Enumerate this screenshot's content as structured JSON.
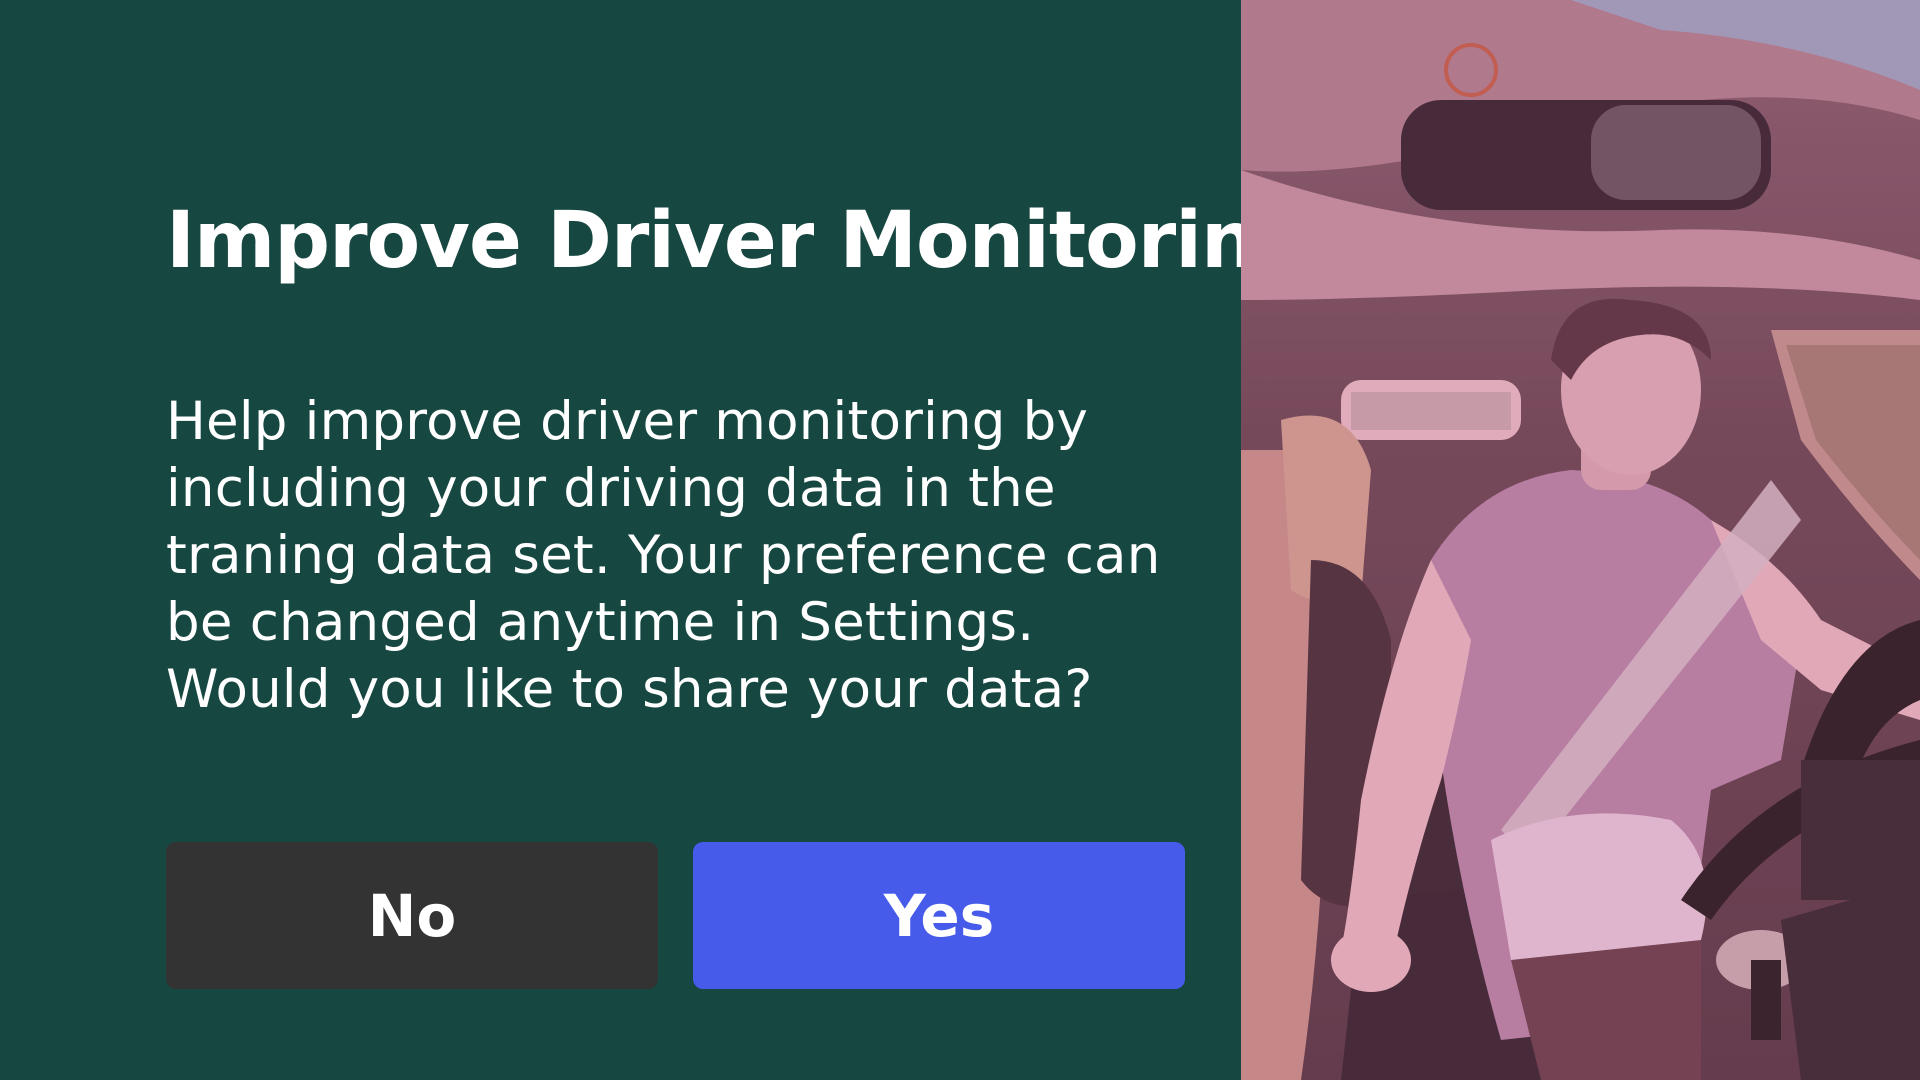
{
  "dialog": {
    "title": "Improve Driver Monitoring",
    "body": "Help improve driver monitoring by including your driving data in the traning data set. Your preference can be changed anytime in Settings. Would you like to share your data?",
    "buttons": {
      "no_label": "No",
      "yes_label": "Yes"
    }
  },
  "camera_preview": {
    "icon": "driver-camera-feed",
    "description_colors": {
      "tint": "#b8778e"
    }
  },
  "colors": {
    "panel_background": "#164741",
    "no_button": "#333333",
    "yes_button": "#465bea",
    "text": "#ffffff"
  }
}
